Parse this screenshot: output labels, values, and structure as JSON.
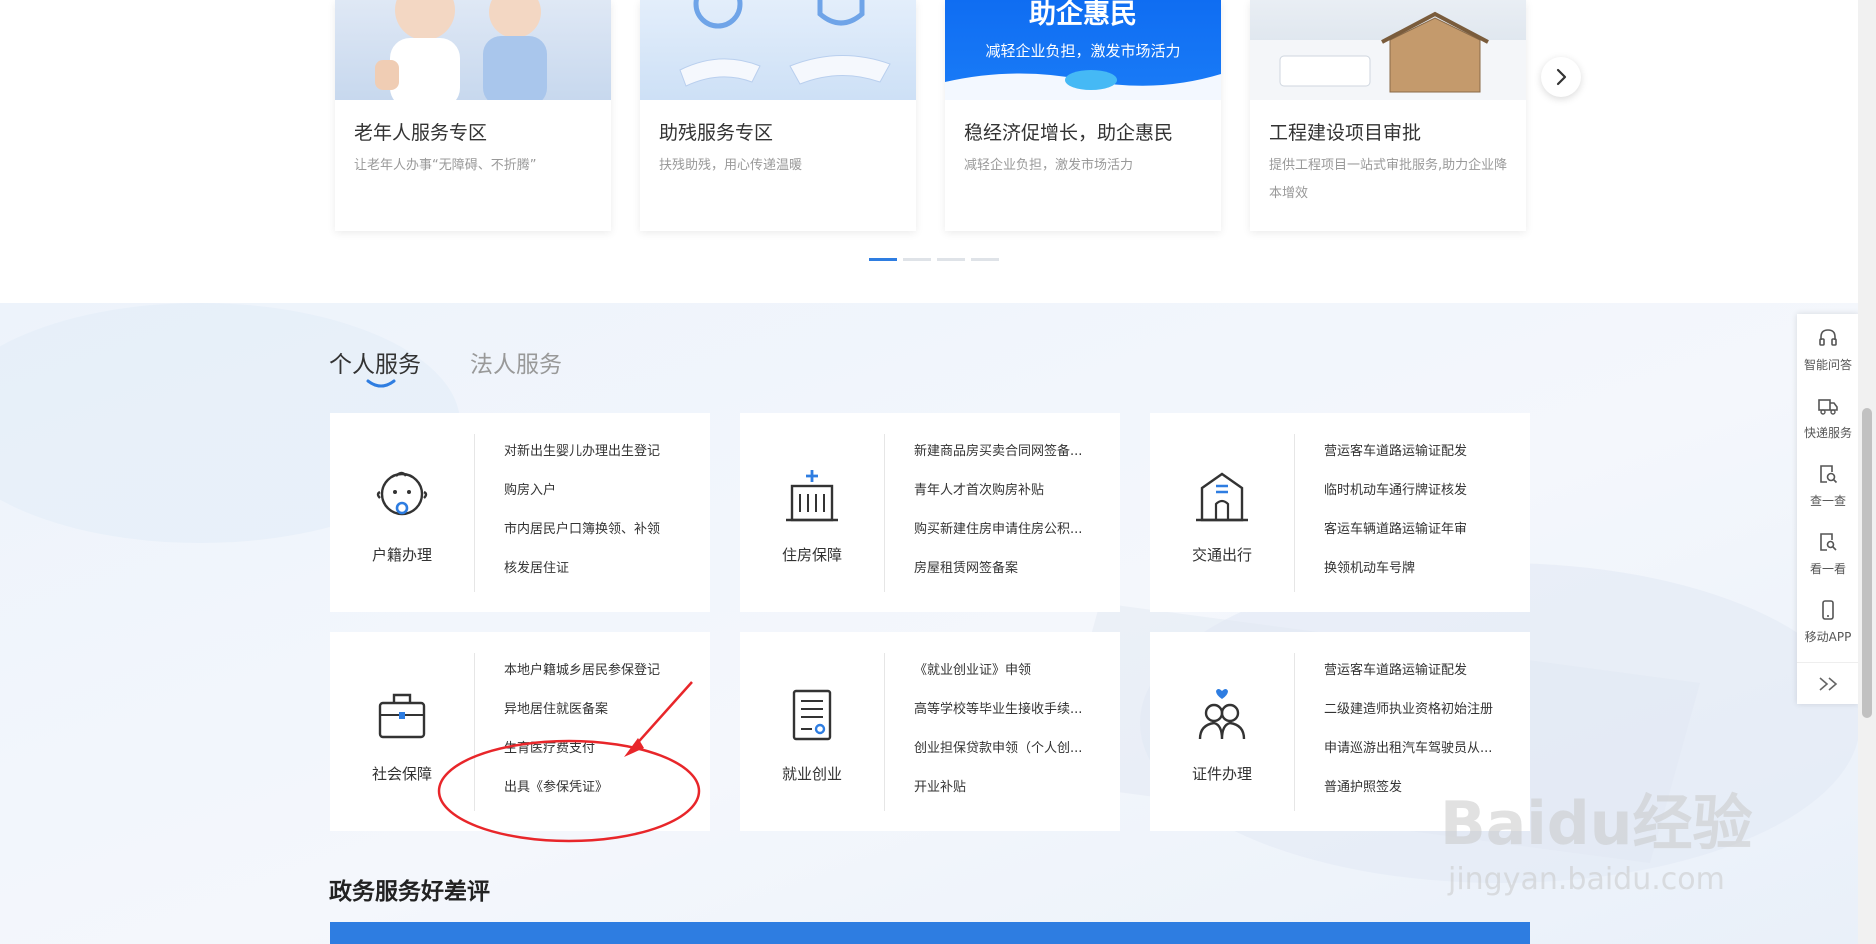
{
  "carousel": {
    "cards": [
      {
        "title": "老年人服务专区",
        "desc": "让老年人办事“无障碍、不折腾”"
      },
      {
        "title": "助残服务专区",
        "desc": "扶残助残，用心传递温暖"
      },
      {
        "title": "稳经济促增长，助企惠民",
        "desc": "减轻企业负担，激发市场活力",
        "banner_big": "助企惠民",
        "banner_small": "减轻企业负担，激发市场活力"
      },
      {
        "title": "工程建设项目审批",
        "desc": "提供工程项目一站式审批服务,助力企业降本增效"
      }
    ],
    "dots_total": 4,
    "active_dot": 1
  },
  "tabs": {
    "personal": "个人服务",
    "legal": "法人服务",
    "active": "personal"
  },
  "services": [
    {
      "name": "户籍办理",
      "icon": "baby-icon",
      "links": [
        "对新出生婴儿办理出生登记",
        "购房入户",
        "市内居民户口簿换领、补领",
        "核发居住证"
      ]
    },
    {
      "name": "住房保障",
      "icon": "building-icon",
      "links": [
        "新建商品房买卖合同网签备...",
        "青年人才首次购房补贴",
        "购买新建住房申请住房公积...",
        "房屋租赁网签备案"
      ]
    },
    {
      "name": "交通出行",
      "icon": "station-icon",
      "links": [
        "营运客车道路运输证配发",
        "临时机动车通行牌证核发",
        "客运车辆道路运输证年审",
        "换领机动车号牌"
      ]
    },
    {
      "name": "社会保障",
      "icon": "briefcase-icon",
      "links": [
        "本地户籍城乡居民参保登记",
        "异地居住就医备案",
        "生育医疗费支付",
        "出具《参保凭证》"
      ]
    },
    {
      "name": "就业创业",
      "icon": "document-icon",
      "links": [
        "《就业创业证》申领",
        "高等学校等毕业生接收手续...",
        "创业担保贷款申领（个人创...",
        "开业补贴"
      ]
    },
    {
      "name": "证件办理",
      "icon": "people-icon",
      "links": [
        "营运客车道路运输证配发",
        "二级建造师执业资格初始注册",
        "申请巡游出租汽车驾驶员从...",
        "普通护照签发"
      ]
    }
  ],
  "review": {
    "title": "政务服务好差评"
  },
  "side_toolbar": {
    "items": [
      {
        "label": "智能问答",
        "icon": "headset-icon"
      },
      {
        "label": "快递服务",
        "icon": "truck-icon"
      },
      {
        "label": "查一查",
        "icon": "search-doc-icon"
      },
      {
        "label": "看一看",
        "icon": "view-doc-icon"
      },
      {
        "label": "移动APP",
        "icon": "phone-icon"
      }
    ],
    "collapse_icon": "double-chevron-right-icon"
  },
  "watermark": {
    "logo": "Baidu经验",
    "url": "jingyan.baidu.com"
  },
  "colors": {
    "accent": "#2e7de1",
    "annotation": "#e8262a",
    "card_bg": "#ffffff",
    "muted_text": "#999999"
  }
}
